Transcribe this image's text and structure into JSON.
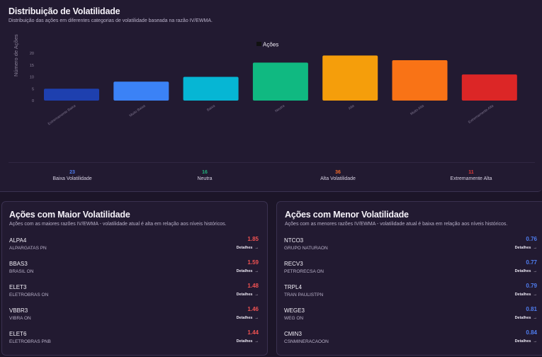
{
  "distribution": {
    "title": "Distribuição de Volatilidade",
    "subtitle": "Distribuição das ações em diferentes categorias de volatilidade baseada na razão IV/EWMA.",
    "summary": [
      {
        "value": "23",
        "label": "Baixa Volatilidade",
        "color": "#4f7df0"
      },
      {
        "value": "16",
        "label": "Neutra",
        "color": "#22b07a"
      },
      {
        "value": "36",
        "label": "Alta Volatilidade",
        "color": "#f26a2a"
      },
      {
        "value": "11",
        "label": "Extremamente Alta",
        "color": "#e23a3a"
      }
    ]
  },
  "chart_data": {
    "type": "bar",
    "ylabel": "Número de Ações",
    "legend": "Ações",
    "legend_position": "top-center",
    "yticks": [
      "0",
      "5",
      "10",
      "15",
      "20"
    ],
    "ylim": [
      0,
      20
    ],
    "grid": false,
    "categories": [
      "Extremamente Baixa",
      "Muito Baixa",
      "Baixa",
      "Neutra",
      "Alta",
      "Muito Alta",
      "Extremamente Alta"
    ],
    "values": [
      5,
      8,
      10,
      16,
      19,
      17,
      11
    ],
    "colors": [
      "#1e40af",
      "#3b82f6",
      "#06b6d4",
      "#10b981",
      "#f59e0b",
      "#f97316",
      "#dc2626"
    ]
  },
  "high": {
    "title": "Ações com Maior Volatilidade",
    "subtitle": "Ações com as maiores razões IV/EWMA - volatilidade atual é alta em relação aos níveis históricos.",
    "details_label": "Detalhes",
    "ratio_color": "#f05252",
    "items": [
      {
        "ticker": "ALPA4",
        "name": "ALPARGATAS PN",
        "ratio": "1.85"
      },
      {
        "ticker": "BBAS3",
        "name": "BRASIL ON",
        "ratio": "1.59"
      },
      {
        "ticker": "ELET3",
        "name": "ELETROBRAS ON",
        "ratio": "1.48"
      },
      {
        "ticker": "VBBR3",
        "name": "VIBRA ON",
        "ratio": "1.46"
      },
      {
        "ticker": "ELET6",
        "name": "ELETROBRAS PNB",
        "ratio": "1.44"
      }
    ]
  },
  "low": {
    "title": "Ações com Menor Volatilidade",
    "subtitle": "Ações com as menores razões IV/EWMA - volatilidade atual é baixa em relação aos níveis históricos.",
    "details_label": "Detalhes",
    "ratio_color": "#4f7df0",
    "items": [
      {
        "ticker": "NTCO3",
        "name": "GRUPO NATURAON",
        "ratio": "0.76"
      },
      {
        "ticker": "RECV3",
        "name": "PETRORECSA ON",
        "ratio": "0.77"
      },
      {
        "ticker": "TRPL4",
        "name": "TRAN PAULISTPN",
        "ratio": "0.79"
      },
      {
        "ticker": "WEGE3",
        "name": "WEG ON",
        "ratio": "0.81"
      },
      {
        "ticker": "CMIN3",
        "name": "CSNMINERACAOON",
        "ratio": "0.84"
      }
    ]
  }
}
